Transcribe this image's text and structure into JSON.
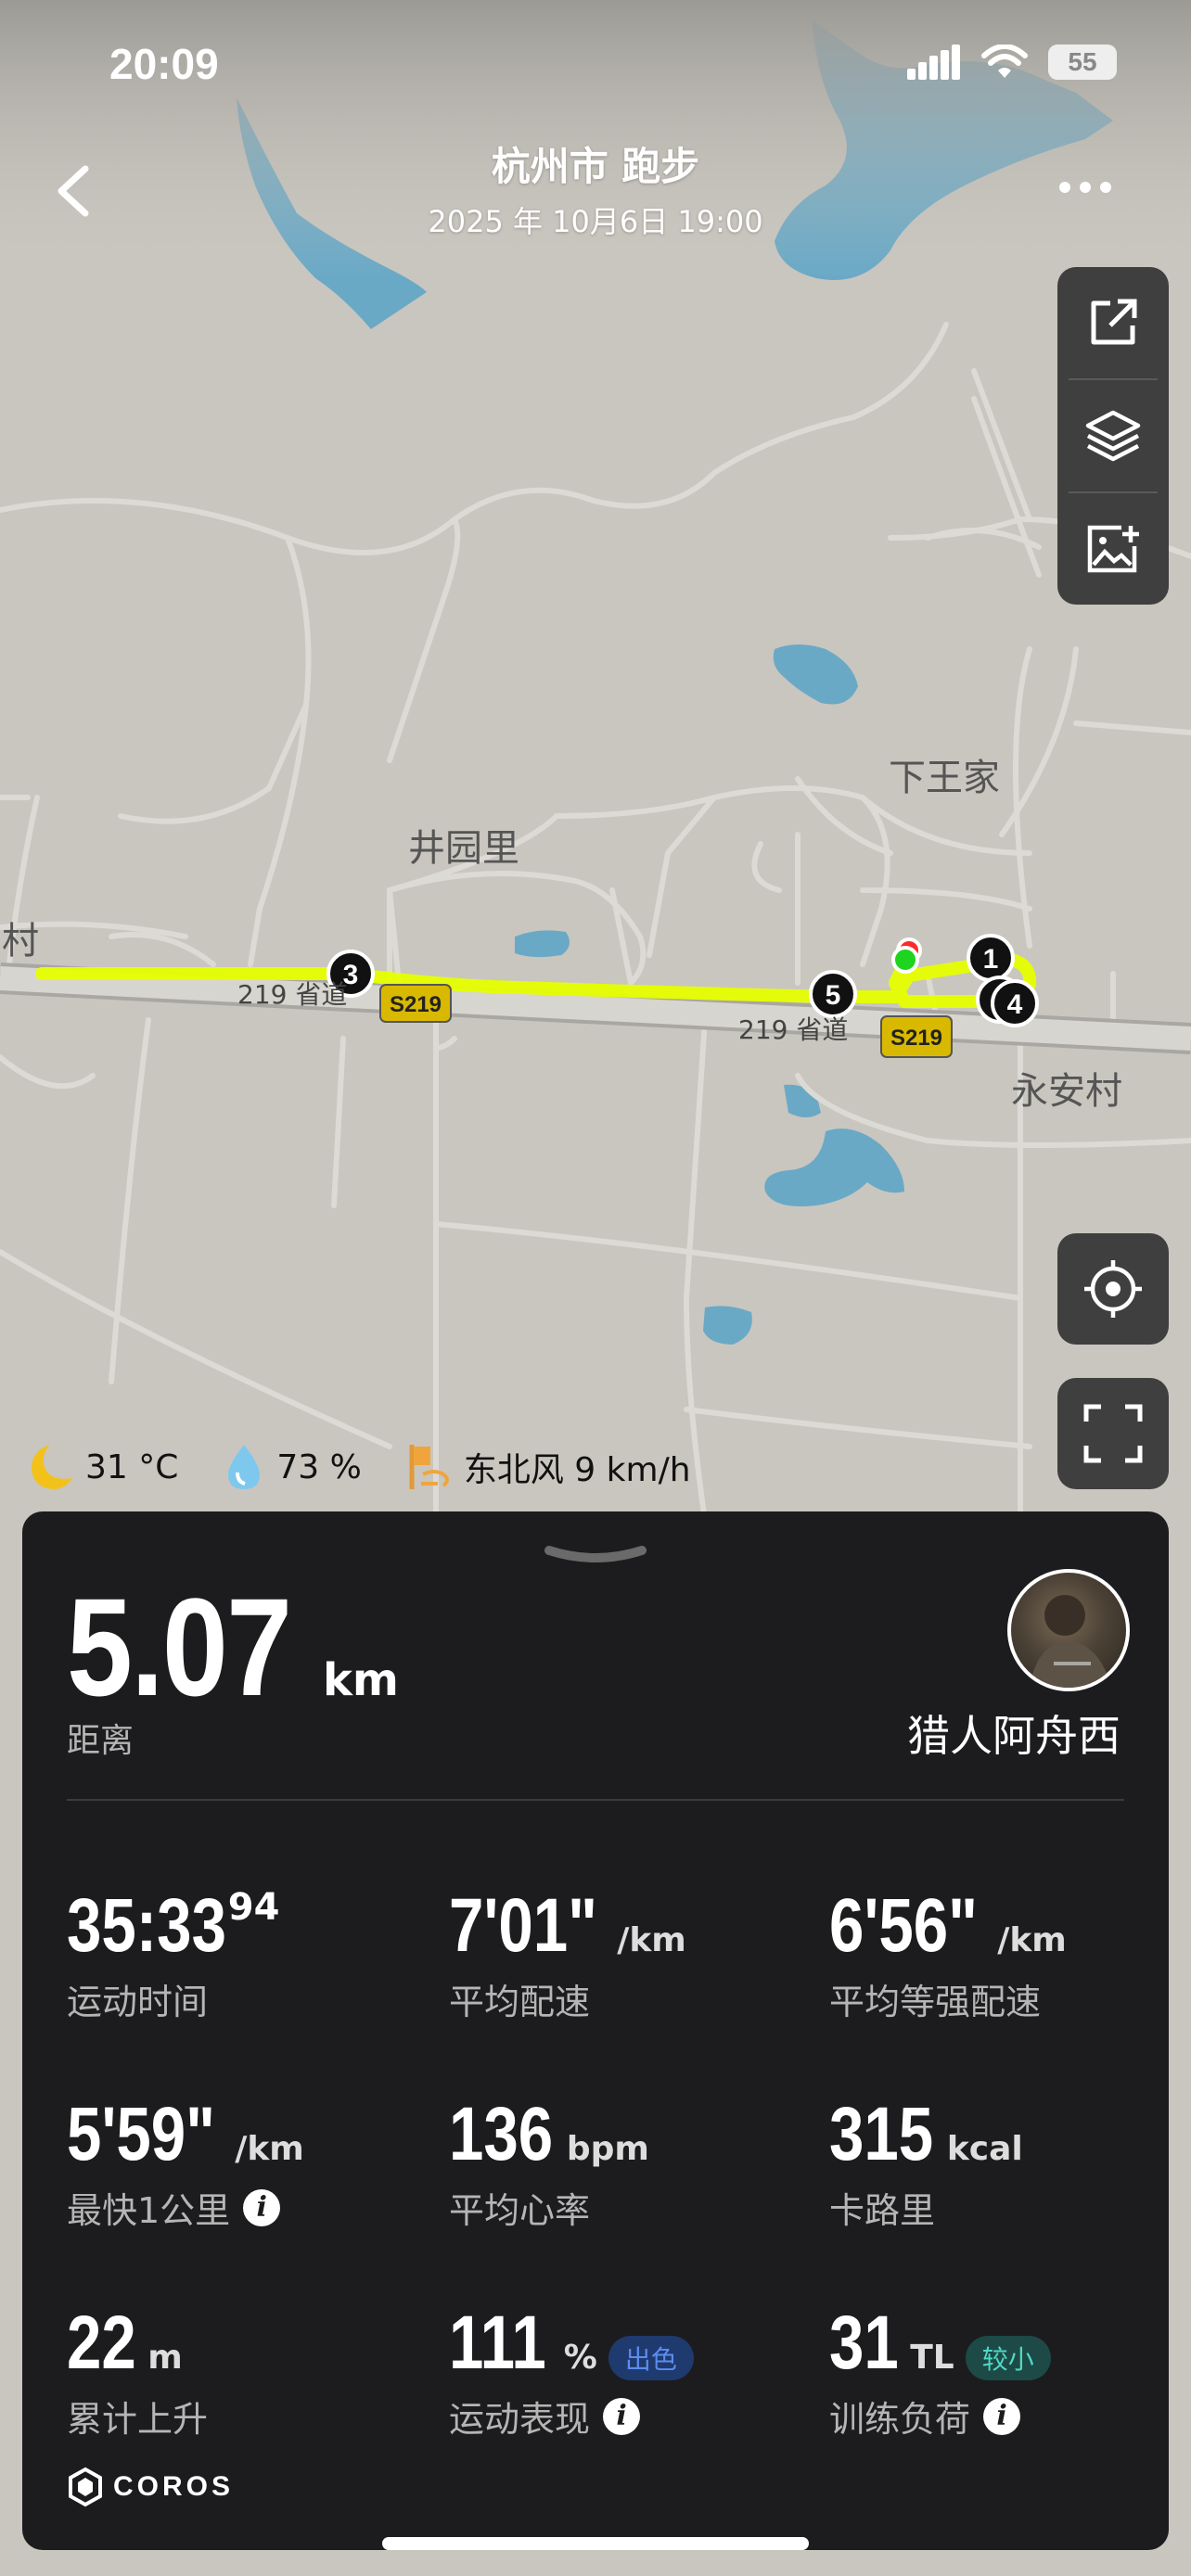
{
  "status_bar": {
    "time": "20:09",
    "battery": "55"
  },
  "header": {
    "title": "杭州市 跑步",
    "datetime": "2025 年 10月6日 19:00"
  },
  "map": {
    "places": {
      "xiawangjia": "下王家",
      "jingyuanli": "井园里",
      "cun": "村",
      "yonganCun": "永安村"
    },
    "roads": {
      "road_name": "219 省道",
      "road_badge": "S219"
    },
    "km_markers": [
      "1",
      "3",
      "4",
      "5"
    ],
    "colors": {
      "route": "#e6ff00",
      "water": "#6aa9c6",
      "land": "#c9c6bf",
      "road": "#dcdad4"
    }
  },
  "weather": {
    "temperature": "31 °C",
    "humidity": "73 %",
    "wind": "东北风 9 km/h"
  },
  "summary": {
    "distance_value": "5.07",
    "distance_unit": "km",
    "distance_label": "距离",
    "username": "猎人阿舟西"
  },
  "stats": {
    "duration": {
      "value": "35:33",
      "sup": "94",
      "label": "运动时间"
    },
    "avg_pace": {
      "value": "7'01\"",
      "unit": "/km",
      "label": "平均配速"
    },
    "avg_grade_pace": {
      "value": "6'56\"",
      "unit": "/km",
      "label": "平均等强配速"
    },
    "fastest_km": {
      "value": "5'59\"",
      "unit": "/km",
      "label": "最快1公里"
    },
    "avg_hr": {
      "value": "136",
      "unit": "bpm",
      "label": "平均心率"
    },
    "calories": {
      "value": "315",
      "unit": "kcal",
      "label": "卡路里"
    },
    "elevation": {
      "value": "22",
      "unit": "m",
      "label": "累计上升"
    },
    "performance": {
      "value": "111",
      "unit": "%",
      "badge": "出色",
      "label": "运动表现"
    },
    "training_load": {
      "value": "31",
      "unit": "TL",
      "badge": "较小",
      "label": "训练负荷"
    }
  },
  "brand": {
    "logo_text": "COROS"
  },
  "info_glyph": "i"
}
